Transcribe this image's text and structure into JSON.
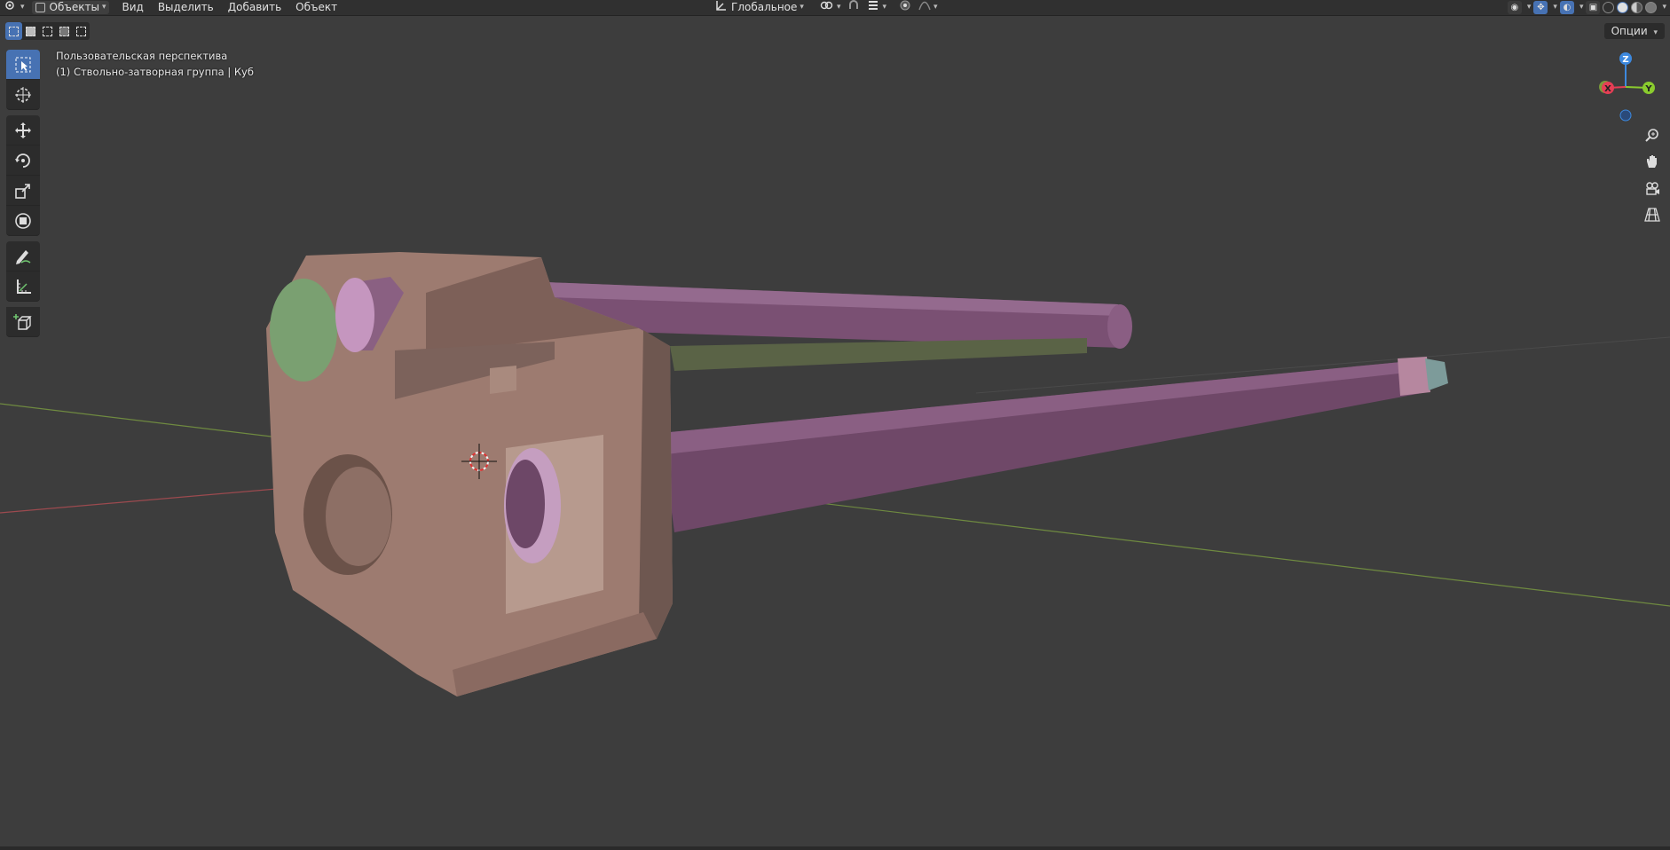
{
  "header": {
    "mode_label": "Объекты",
    "menus": [
      "Вид",
      "Выделить",
      "Добавить",
      "Объект"
    ],
    "orientation_label": "Глобальное"
  },
  "toolbar": {
    "options_label": "Опции"
  },
  "viewport": {
    "view_name": "Пользовательская перспектива",
    "object_info": "(1) Ствольно-затворная группа | Куб"
  },
  "gizmo": {
    "z_label": "Z",
    "y_label": "Y",
    "x_label": "X",
    "colors": {
      "x": "#e53e55",
      "y": "#8acb2e",
      "z": "#3d89df"
    }
  },
  "colors": {
    "background": "#3d3d3d",
    "header": "#303030",
    "accent": "#4772b3",
    "receiver": "#9f7d72",
    "barrel": "#7f547b",
    "green_part": "#7aa071"
  },
  "icons": {
    "editor_type": "editor-type-icon",
    "tools": [
      "select-box-icon",
      "cursor-icon",
      "move-icon",
      "rotate-icon",
      "scale-icon",
      "transform-icon",
      "annotate-icon",
      "measure-icon",
      "add-cube-icon"
    ],
    "nav": [
      "zoom-icon",
      "pan-hand-icon",
      "camera-icon",
      "grid-icon"
    ]
  }
}
